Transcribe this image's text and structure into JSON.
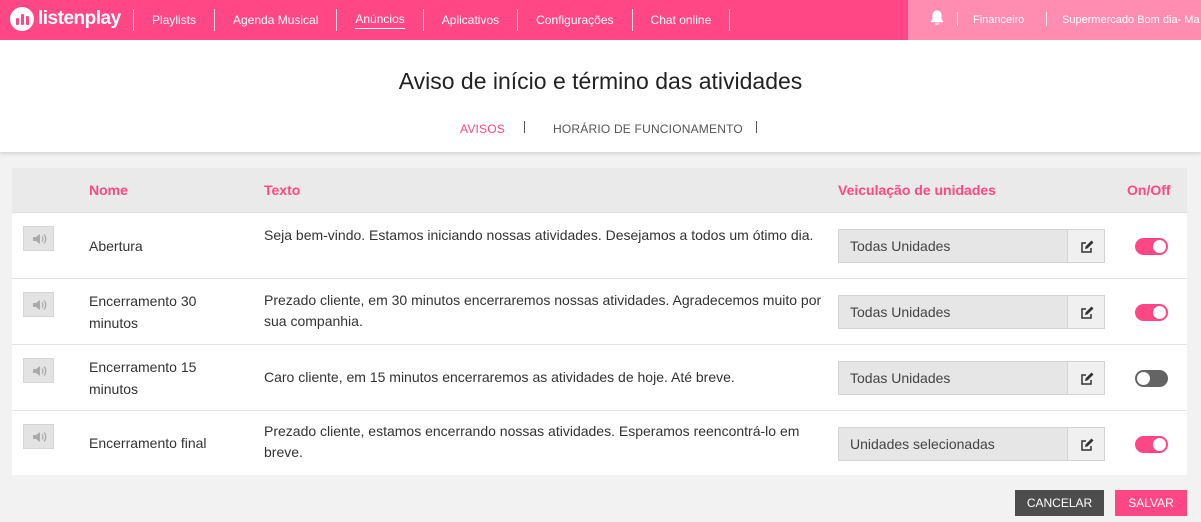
{
  "brand": {
    "name": "listenplay"
  },
  "nav": {
    "items": [
      {
        "label": "Playlists"
      },
      {
        "label": "Agenda Musical"
      },
      {
        "label": "Anúncios"
      },
      {
        "label": "Aplicativos"
      },
      {
        "label": "Configurações"
      },
      {
        "label": "Chat online"
      }
    ],
    "active": "Anúncios"
  },
  "topright": {
    "notifications_icon": "bell-icon",
    "financeiro": "Financeiro",
    "account": "Supermercado Bom dia- Ma"
  },
  "page": {
    "title": "Aviso de início e término das atividades",
    "tabs": [
      {
        "label": "AVISOS",
        "active": true
      },
      {
        "label": "HORÁRIO DE FUNCIONAMENTO",
        "active": false
      }
    ]
  },
  "table": {
    "headers": {
      "nome": "Nome",
      "texto": "Texto",
      "veiculacao": "Veiculação de unidades",
      "onoff": "On/Off"
    },
    "rows": [
      {
        "nome": "Abertura",
        "texto": "Seja bem-vindo. Estamos iniciando nossas atividades. Desejamos a todos um ótimo dia.",
        "unidades": "Todas Unidades",
        "on": true
      },
      {
        "nome": "Encerramento 30 minutos",
        "texto": "Prezado cliente, em 30 minutos encerraremos nossas atividades. Agradecemos muito por sua companhia.",
        "unidades": "Todas Unidades",
        "on": true
      },
      {
        "nome": "Encerramento 15 minutos",
        "texto": "Caro cliente, em 15 minutos encerraremos as atividades de hoje. Até breve.",
        "unidades": "Todas Unidades",
        "on": false
      },
      {
        "nome": "Encerramento final",
        "texto": "Prezado cliente, estamos encerrando nossas atividades. Esperamos reencontrá-lo em breve.",
        "unidades": "Unidades selecionadas",
        "on": true
      }
    ]
  },
  "actions": {
    "cancel": "CANCELAR",
    "save": "SALVAR"
  },
  "colors": {
    "accent": "#ff4785",
    "accent_light": "#ff8db2",
    "toggle_off": "#646464",
    "cancel_bg": "#4d4d4d"
  }
}
